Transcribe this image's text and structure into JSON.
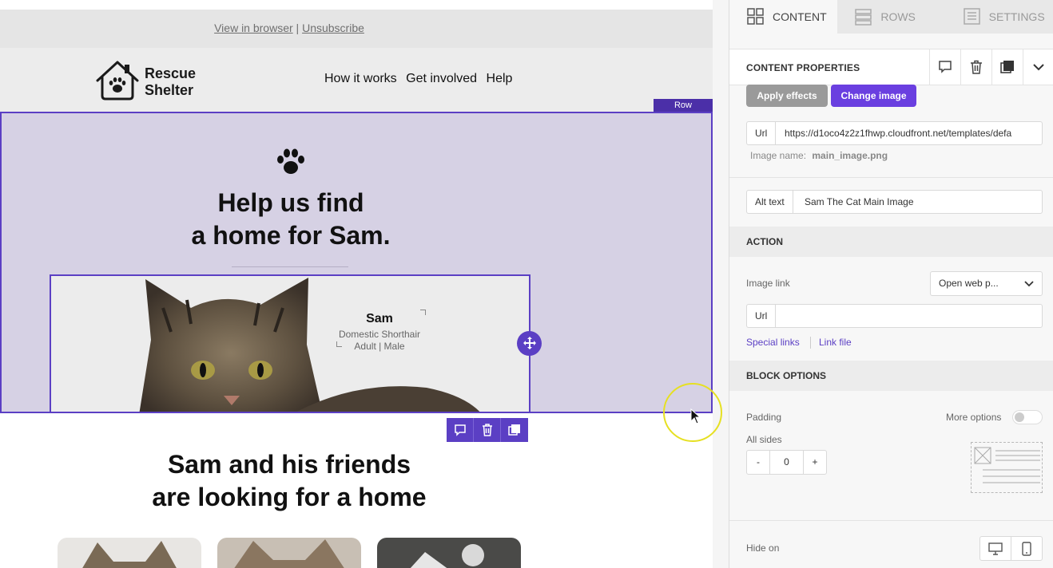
{
  "email": {
    "topbar": {
      "view_in_browser": "View in browser",
      "separator": " | ",
      "unsubscribe": "Unsubscribe"
    },
    "logo": {
      "line1": "Rescue",
      "line2": "Shelter"
    },
    "nav": [
      "How it works",
      "Get involved",
      "Help"
    ],
    "row_tag": "Row",
    "hero": {
      "title_line1": "Help us find",
      "title_line2": "a home for Sam."
    },
    "cat_card": {
      "name": "Sam",
      "breed": "Domestic Shorthair",
      "details": "Adult | Male"
    },
    "subtitle": {
      "line1": "Sam and his friends",
      "line2": "are looking for a home"
    }
  },
  "panel": {
    "tabs": [
      {
        "label": "CONTENT",
        "icon": "grid-icon"
      },
      {
        "label": "ROWS",
        "icon": "rows-icon"
      },
      {
        "label": "SETTINGS",
        "icon": "settings-list-icon"
      }
    ],
    "props_title": "CONTENT PROPERTIES",
    "apply_effects": "Apply effects",
    "change_image": "Change image",
    "url_label": "Url",
    "url_value": "https://d1oco4z2z1fhwp.cloudfront.net/templates/defa",
    "image_name_label": "Image name:",
    "image_name": "main_image.png",
    "alt_label": "Alt text",
    "alt_value": "Sam The Cat Main Image",
    "action_section": "ACTION",
    "image_link_label": "Image link",
    "image_link_select": "Open web p...",
    "link_url_label": "Url",
    "link_url_value": "",
    "special_links": "Special links",
    "link_file": "Link file",
    "block_options_section": "BLOCK OPTIONS",
    "padding_label": "Padding",
    "more_options": "More options",
    "all_sides": "All sides",
    "stepper": {
      "minus": "-",
      "value": "0",
      "plus": "+"
    },
    "hide_on": "Hide on"
  },
  "colors": {
    "accent": "#5b3fc4",
    "button_primary": "#6a3fe0",
    "hero_bg": "#d6d1e4"
  }
}
